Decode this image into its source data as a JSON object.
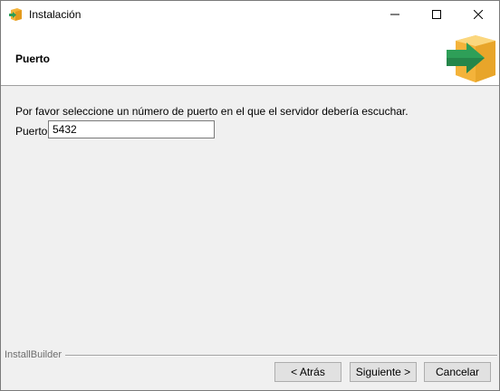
{
  "window": {
    "title": "Instalación",
    "icons": {
      "app": "installer-box-icon",
      "minimize": "minimize-icon",
      "maximize": "maximize-icon",
      "close": "close-icon"
    }
  },
  "header": {
    "title": "Puerto",
    "logo": "installer-box-arrow-icon"
  },
  "content": {
    "prompt": "Por favor seleccione un número de puerto en el que el servidor debería escuchar.",
    "port_label": "Puerto",
    "port_value": "5432"
  },
  "footer": {
    "brand": "InstallBuilder",
    "back_label": "< Atrás",
    "next_label": "Siguiente >",
    "cancel_label": "Cancelar"
  },
  "colors": {
    "box_orange": "#f4b33a",
    "arrow_green": "#2e9f58"
  }
}
